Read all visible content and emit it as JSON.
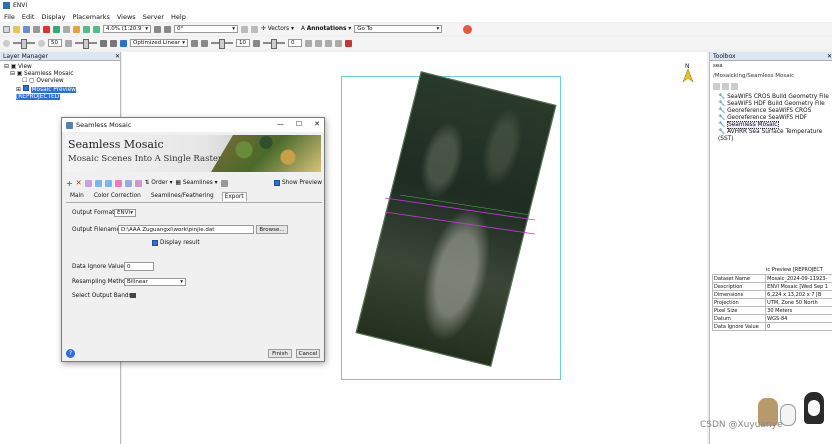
{
  "app": {
    "title": "ENVI"
  },
  "menu": [
    "File",
    "Edit",
    "Display",
    "Placemarks",
    "Views",
    "Server",
    "Help"
  ],
  "toolbar1": {
    "zoom_value": "4.0% (1:20.9",
    "rotate_value": "0°",
    "vectors_label": "Vectors",
    "annotations_label": "Annotations",
    "goto_label": "Go To"
  },
  "toolbar2": {
    "brightness_value": "50",
    "stretch_value": "Optimized Linear",
    "sharpen_value": "10",
    "transparency_value": "0"
  },
  "layer_manager": {
    "title": "Layer Manager",
    "items": [
      "View",
      "Seamless Mosaic",
      "Overview",
      "Mosaic Preview [REPROJECTED"
    ]
  },
  "dialog": {
    "title": "Seamless Mosaic",
    "banner_title": "Seamless Mosaic",
    "banner_subtitle": "Mosaic Scenes Into A Single Raster",
    "order_label": "Order",
    "seamlines_label": "Seamlines",
    "show_preview_label": "Show Preview",
    "tabs": [
      "Main",
      "Color Correction",
      "Seamlines/Feathering",
      "Export"
    ],
    "output_format_label": "Output Format",
    "output_format_value": "ENVI",
    "output_filename_label": "Output Filename",
    "output_filename_value": "D:\\AAA Zuguangxi\\work\\pinjie.dat",
    "browse_label": "Browse...",
    "display_result_label": "Display result",
    "data_ignore_label": "Data Ignore Value",
    "data_ignore_value": "0",
    "resampling_label": "Resampling Method",
    "resampling_value": "Bilinear",
    "select_bands_label": "Select Output Bands",
    "finish_label": "Finish",
    "cancel_label": "Cancel",
    "help_label": "?"
  },
  "toolbox": {
    "title": "Toolbox",
    "search_value": "sea",
    "path": "/Mosaicking/Seamless Mosaic",
    "items": [
      "SeaWiFS CROS Build Geometry File",
      "SeaWiFS HDF Build Geometry File",
      "Georeference SeaWiFS CROS",
      "Georeference SeaWiFS HDF",
      "Seamless Mosaic",
      "AVHRR Sea Surface Temperature (SST)"
    ]
  },
  "properties": {
    "header": "ic Preview [REPROJECT",
    "rows": [
      [
        "Dataset Name",
        "Mosaic_2024-09-11923-"
      ],
      [
        "Description",
        "ENVI Mosaic [Wed Sep 1"
      ],
      [
        "Dimensions",
        "6,224 x 13,202 x 7 [B"
      ],
      [
        "Projection",
        "UTM, Zone 50 North"
      ],
      [
        "Pixel Size",
        "30 Meters"
      ],
      [
        "Datum",
        "WGS-84"
      ],
      [
        "Data Ignore Value",
        "0"
      ]
    ]
  },
  "watermark": "CSDN @Xuyuanye",
  "colors": {
    "accent": "#2a6fdb",
    "frame": "#6ccfd6",
    "panel_header": "#dde6f2"
  }
}
